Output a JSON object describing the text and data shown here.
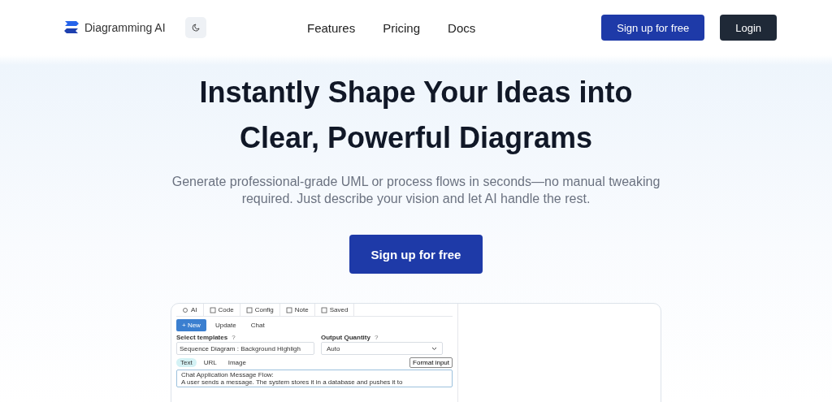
{
  "header": {
    "brand": "Diagramming AI",
    "nav": [
      "Features",
      "Pricing",
      "Docs"
    ],
    "signup": "Sign up for free",
    "login": "Login"
  },
  "hero": {
    "title_lines": [
      "Instantly Shape Your Ideas into",
      "Clear, Powerful Diagrams"
    ],
    "subtitle_lines": [
      "Generate professional-grade UML or process flows in seconds—no manual tweaking",
      "required. Just describe your vision and let AI handle the rest."
    ],
    "cta": "Sign up for free"
  },
  "preview": {
    "tabs": [
      {
        "label": "AI",
        "selected": false
      },
      {
        "label": "Code",
        "selected": false
      },
      {
        "label": "Config",
        "selected": false
      },
      {
        "label": "Note",
        "selected": false
      },
      {
        "label": "Saved",
        "selected": false
      }
    ],
    "actions": [
      {
        "label": "+ New",
        "selected": true
      },
      {
        "label": "Update",
        "selected": false
      },
      {
        "label": "Chat",
        "selected": false
      }
    ],
    "template_label": "Select templates",
    "template_help": "?",
    "template_value": "Sequence Diagram : Background Highligh",
    "quantity_label": "Output Quantity",
    "quantity_help": "?",
    "quantity_value": "Auto",
    "input_tabs": [
      {
        "label": "Text",
        "selected": true
      },
      {
        "label": "URL",
        "selected": false
      },
      {
        "label": "Image",
        "selected": false
      }
    ],
    "format_button": "Format input",
    "text_lines": [
      "Chat Application Message Flow:",
      "A user sends a message. The system stores it in a database and pushes it to"
    ]
  }
}
